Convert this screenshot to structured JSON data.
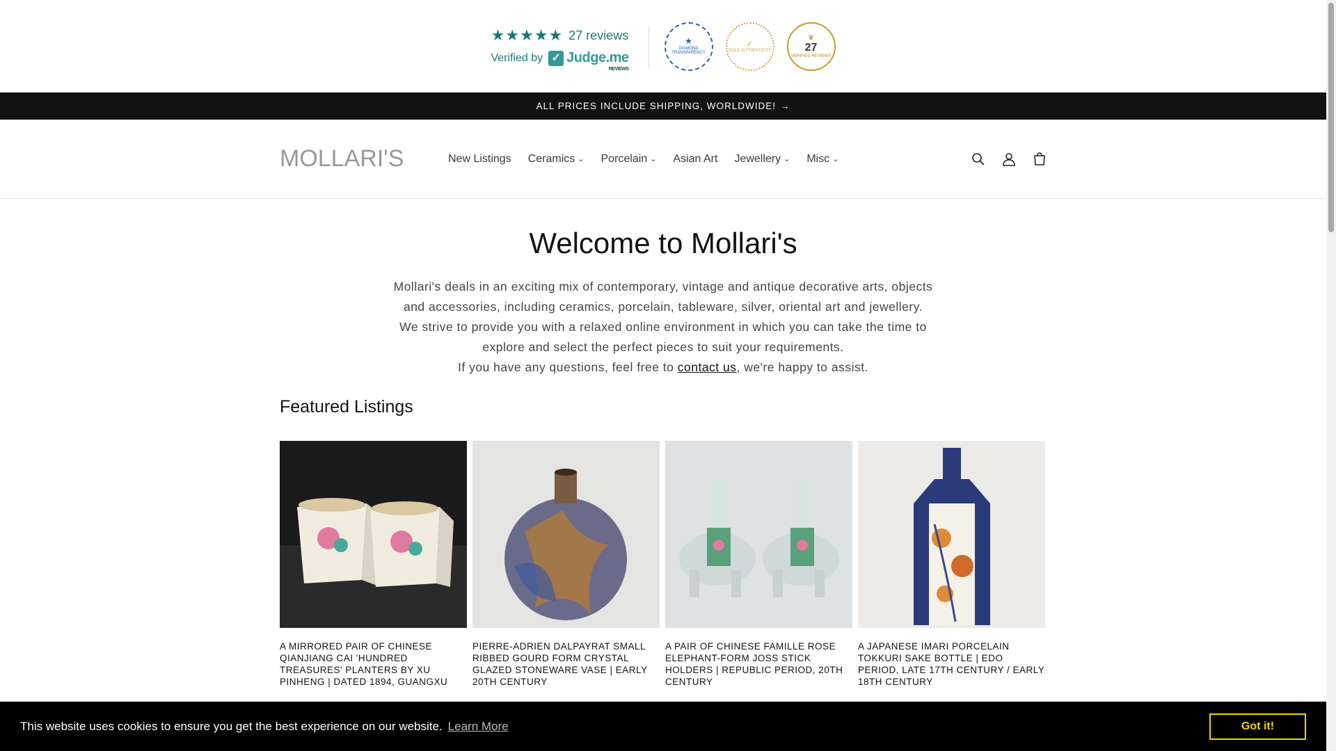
{
  "reviews": {
    "stars": "★★★★★",
    "count_label": "27 reviews",
    "verified_label": "Verified by",
    "judgeme_name": "Judge.me",
    "judgeme_sub": "REVIEWS",
    "medals": [
      {
        "text": "DIAMOND TRANSPARENCY"
      },
      {
        "text": "GOLD AUTHENTICITY"
      },
      {
        "num": "27",
        "text": "VERIFIED REVIEWS"
      }
    ]
  },
  "announcement": {
    "text": "ALL PRICES INCLUDE SHIPPING, WORLDWIDE!",
    "arrow": "→"
  },
  "header": {
    "logo": "MOLLARI'S",
    "nav": [
      {
        "label": "New Listings",
        "dropdown": false
      },
      {
        "label": "Ceramics",
        "dropdown": true
      },
      {
        "label": "Porcelain",
        "dropdown": true
      },
      {
        "label": "Asian Art",
        "dropdown": false
      },
      {
        "label": "Jewellery",
        "dropdown": true
      },
      {
        "label": "Misc",
        "dropdown": true
      }
    ],
    "icons": [
      "search-icon",
      "account-icon",
      "cart-icon"
    ]
  },
  "welcome": {
    "title": "Welcome to Mollari's",
    "para1": "Mollari's deals in an exciting mix of contemporary, vintage and antique decorative arts, objects and accessories, including ceramics, porcelain, tableware, silver, oriental art and jewellery.",
    "para2": "We strive to provide you with a relaxed online environment in which you can take the time to explore and select the perfect pieces to suit your requirements.",
    "contact_pre": "If you have any questions, feel free to ",
    "contact_link": "contact us",
    "contact_post": ", we're happy to assist."
  },
  "featured": {
    "heading": "Featured Listings",
    "items": [
      {
        "title": "A MIRRORED PAIR OF CHINESE QIANJIANG CAI 'HUNDRED TREASURES' PLANTERS BY XU PINHENG | DATED 1894, GUANGXU"
      },
      {
        "title": "PIERRE-ADRIEN DALPAYRAT SMALL RIBBED GOURD FORM CRYSTAL GLAZED STONEWARE VASE | EARLY 20TH CENTURY"
      },
      {
        "title": "A PAIR OF CHINESE FAMILLE ROSE ELEPHANT-FORM JOSS STICK HOLDERS | REPUBLIC PERIOD, 20TH CENTURY"
      },
      {
        "title": "A JAPANESE IMARI PORCELAIN TOKKURI SAKE BOTTLE | EDO PERIOD, LATE 17TH CENTURY / EARLY 18TH CENTURY"
      }
    ]
  },
  "cookie": {
    "message": "This website uses cookies to ensure you get the best experience on our website.",
    "learn_more": "Learn More",
    "button": "Got it!"
  }
}
